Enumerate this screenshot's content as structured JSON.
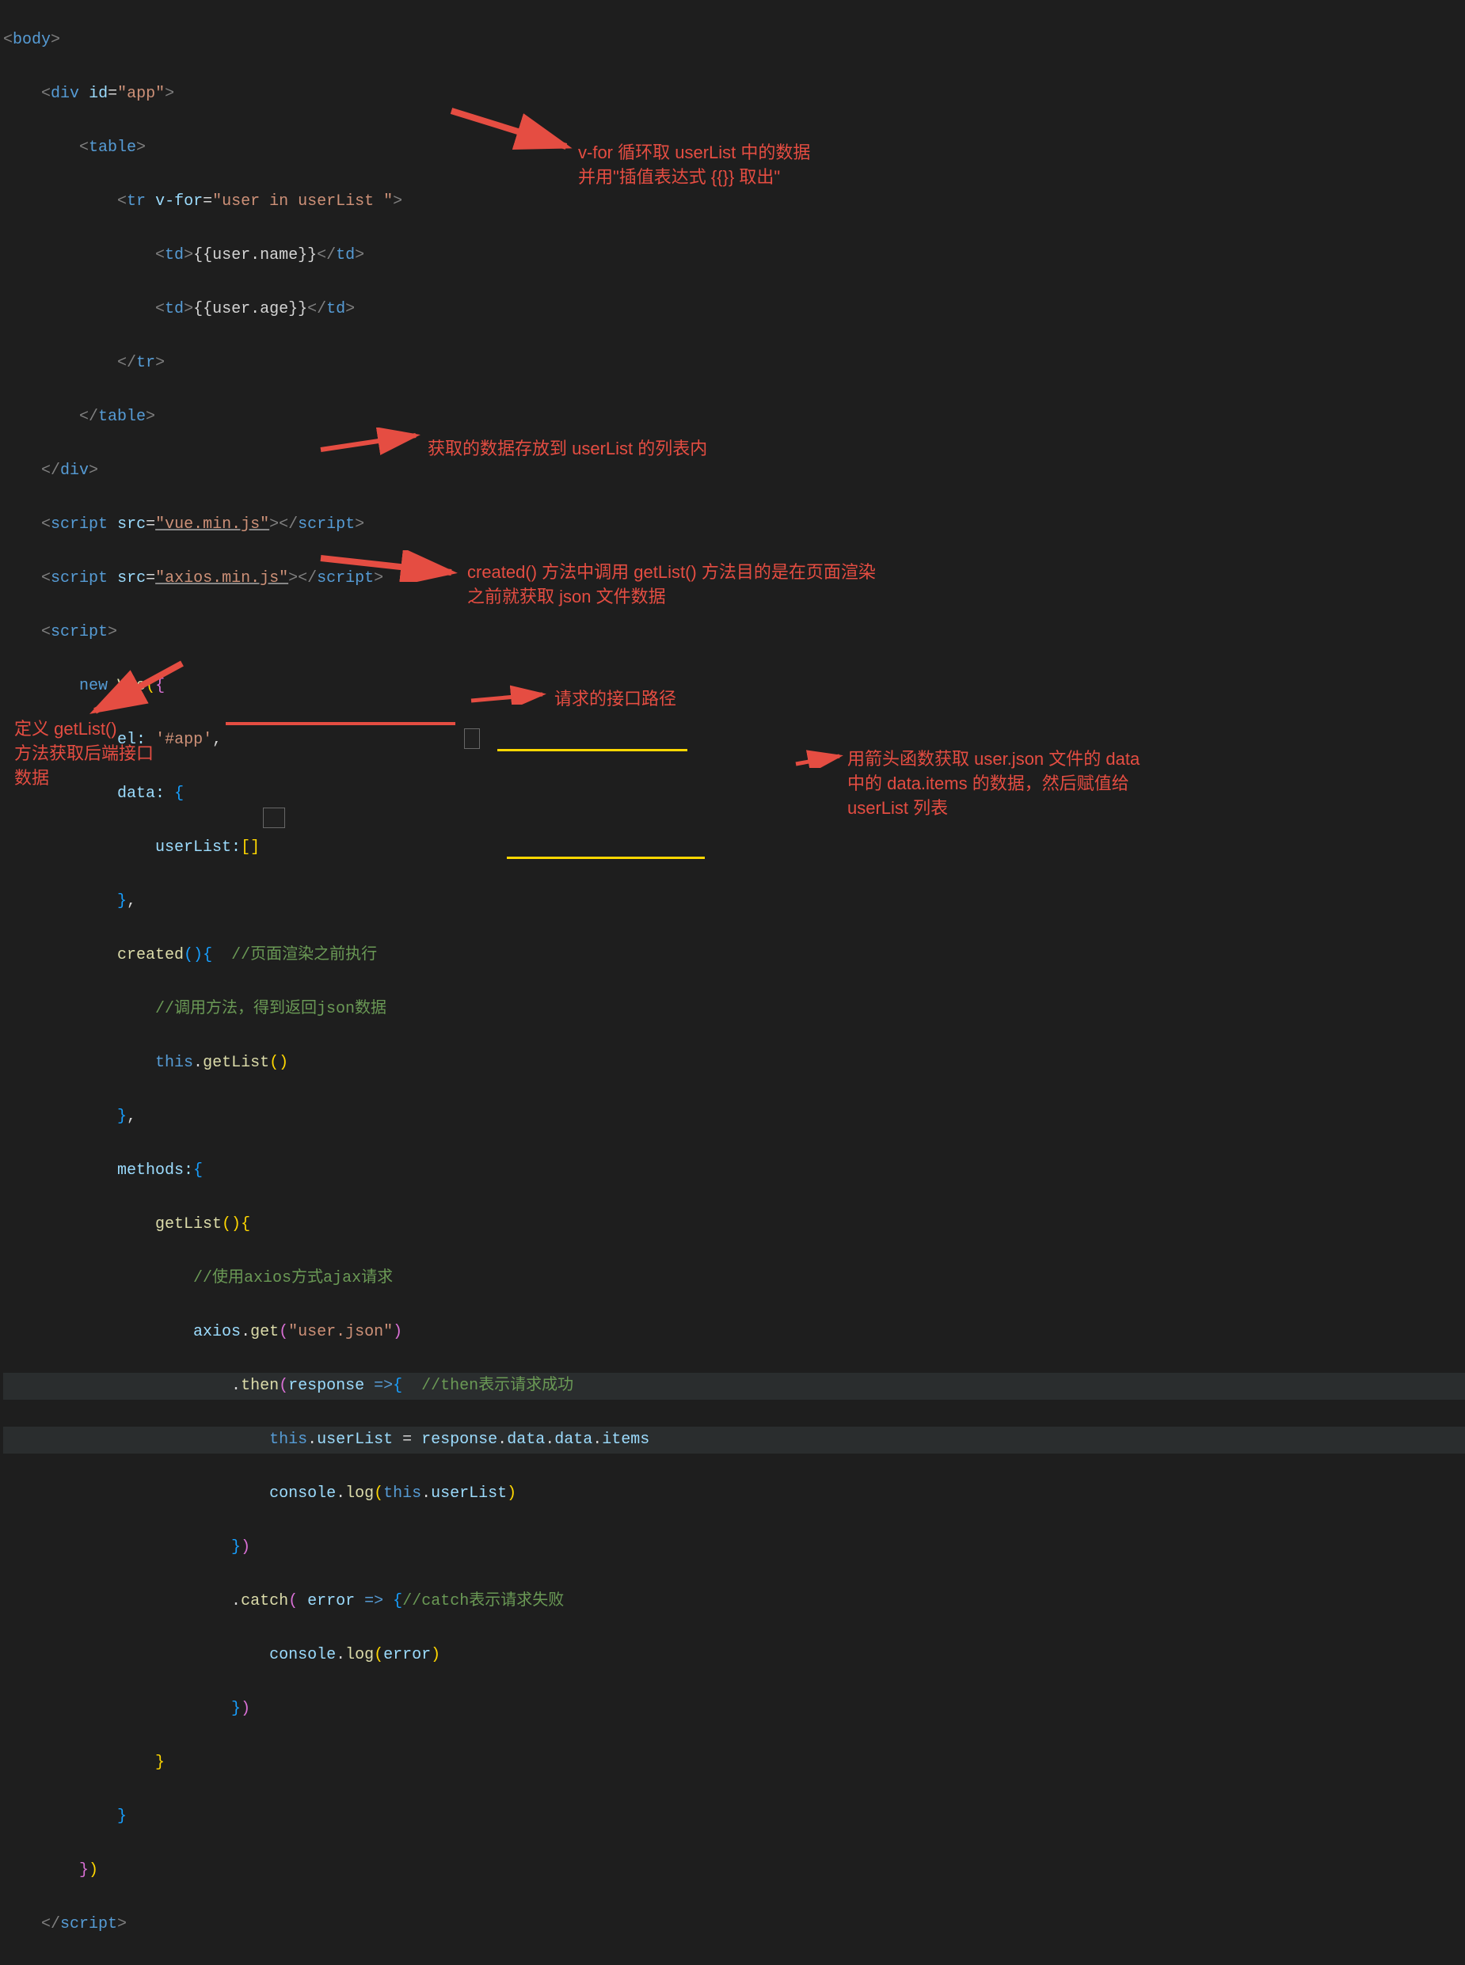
{
  "code": {
    "l1_body": "body",
    "l2_div": "div",
    "l2_id_attr": "id",
    "l2_id_val": "\"app\"",
    "l3_table": "table",
    "l4_tr": "tr",
    "l4_vfor_attr": "v-for",
    "l4_vfor_val": "\"user in userList \"",
    "l5_td": "td",
    "l5_expr1": "{{user.name}}",
    "l6_expr2": "{{user.age}}",
    "l9_script": "script",
    "l9_src_attr": "src",
    "l9_src_val": "\"vue.min.js\"",
    "l10_src_val": "\"axios.min.js\"",
    "l12_new": "new",
    "l12_vue": "Vue",
    "l13_el": "el:",
    "l13_el_val": "'#app'",
    "l14_data": "data:",
    "l15_userList": "userList:",
    "l15_brackets": "[]",
    "l17_created": "created",
    "l17_comment": "//页面渲染之前执行",
    "l18_comment": "//调用方法，得到返回json数据",
    "l19_this": "this",
    "l19_getList": "getList",
    "l21_methods": "methods:",
    "l22_getList": "getList",
    "l23_comment": "//使用axios方式ajax请求",
    "l24_axios": "axios",
    "l24_get": "get",
    "l24_url": "\"user.json\"",
    "l25_then": "then",
    "l25_response": "response",
    "l25_arrow": "=>",
    "l25_comment": "//then表示请求成功",
    "l26_this": "this",
    "l26_userList_assign": "userList",
    "l26_response": "response",
    "l26_data1": "data",
    "l26_data2": "data",
    "l26_items": "items",
    "l27_console": "console",
    "l27_log": "log",
    "l27_this": "this",
    "l27_userList": "userList",
    "l29_catch": "catch",
    "l29_error": "error",
    "l29_comment": "//catch表示请求失败",
    "l30_console": "console",
    "l30_log": "log",
    "l30_error": "error"
  },
  "annotations": {
    "a1_line1": "v-for 循环取 userList 中的数据",
    "a1_line2": "并用\"插值表达式 {{}} 取出\"",
    "a2": "获取的数据存放到 userList 的列表内",
    "a3_line1": "created() 方法中调用 getList() 方法目的是在页面渲染",
    "a3_line2": "之前就获取 json 文件数据",
    "a4_line1": "定义 getList()",
    "a4_line2": "方法获取后端接口",
    "a4_line3": "数据",
    "a5": "请求的接口路径",
    "a6_line1": "用箭头函数获取 user.json 文件的 data",
    "a6_line2": "中的 data.items 的数据，然后赋值给",
    "a6_line3": "userList 列表"
  }
}
